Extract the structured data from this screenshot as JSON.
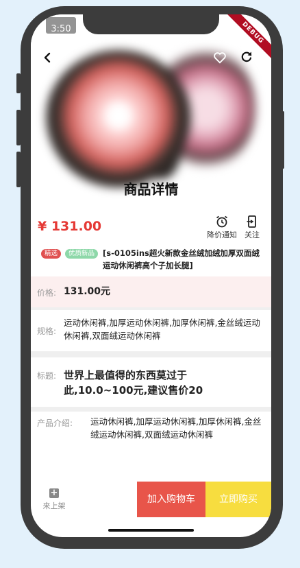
{
  "status_bar": {
    "time": "3:50"
  },
  "debug_banner": "DEBUG",
  "header": {
    "title": "商品详情",
    "icons": {
      "back": "chevron-left-icon",
      "favorite": "heart-outline-icon",
      "refresh": "refresh-icon"
    }
  },
  "product": {
    "price": "¥ 131.00",
    "actions": [
      {
        "label": "降价通知",
        "icon": "alarm-clock-icon"
      },
      {
        "label": "关注",
        "icon": "phone-follow-icon"
      }
    ],
    "tags": [
      "精选",
      "优质新品"
    ],
    "name": "[s-0105ins超火新款金丝绒加绒加厚双面绒运动休闲裤高个子加长腿]"
  },
  "details": {
    "price_label": "价格:",
    "price_value": "131.00元",
    "spec_label": "规格:",
    "spec_value": "运动休闲裤,加厚运动休闲裤,加厚休闲裤,金丝绒运动休闲裤,双面绒运动休闲裤",
    "title_label": "标题:",
    "title_value": "世界上最值得的东西莫过于此,10.0~100元,建议售价20",
    "intro_label": "产品介绍:",
    "intro_value": "运动休闲裤,加厚运动休闲裤,加厚休闲裤,金丝绒运动休闲裤,双面绒运动休闲裤"
  },
  "bottom_bar": {
    "shelf_label": "来上架",
    "shelf_icon": "plus-square-icon",
    "add_to_cart": "加入购物车",
    "buy_now": "立即购买",
    "colors": {
      "cart": "#e8554a",
      "buy": "#f7dd3f",
      "price": "#e53935"
    }
  }
}
